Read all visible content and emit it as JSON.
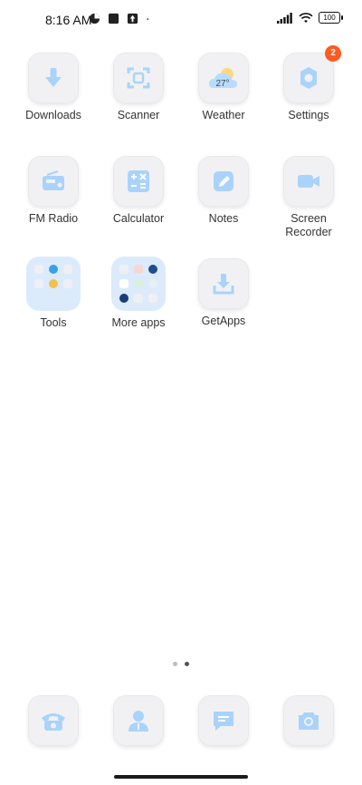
{
  "status_bar": {
    "time": "8:16 AM",
    "battery": "100"
  },
  "apps": [
    {
      "label": "Downloads",
      "icon": "download-icon"
    },
    {
      "label": "Scanner",
      "icon": "scanner-icon"
    },
    {
      "label": "Weather",
      "icon": "weather-icon",
      "temp": "27°"
    },
    {
      "label": "Settings",
      "icon": "gear-icon",
      "badge": "2"
    },
    {
      "label": "FM Radio",
      "icon": "radio-icon"
    },
    {
      "label": "Calculator",
      "icon": "calculator-icon"
    },
    {
      "label": "Notes",
      "icon": "notes-icon"
    },
    {
      "label": "Screen Recorder",
      "label_line1": "Screen",
      "label_line2": "Recorder",
      "icon": "video-camera-icon"
    },
    {
      "label": "Tools",
      "icon": "folder-icon"
    },
    {
      "label": "More apps",
      "icon": "folder-icon"
    },
    {
      "label": "GetApps",
      "icon": "store-download-icon"
    }
  ],
  "dock": [
    {
      "icon": "phone-icon"
    },
    {
      "icon": "contacts-icon"
    },
    {
      "icon": "messages-icon"
    },
    {
      "icon": "camera-icon"
    }
  ],
  "page_indicator": {
    "count": 2,
    "active_index": 1
  },
  "colors": {
    "accent_blue": "#a9d3fb",
    "tile_bg": "#f1f1f3",
    "badge": "#ff5a1f"
  }
}
